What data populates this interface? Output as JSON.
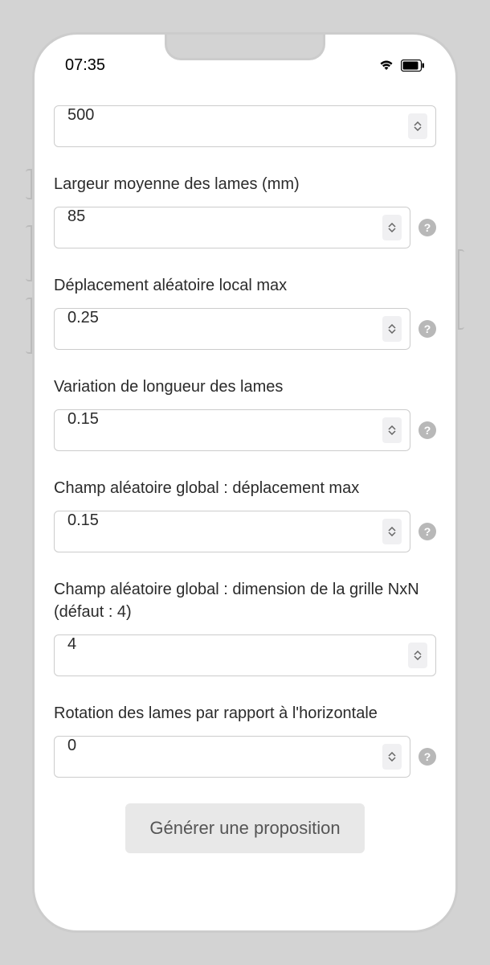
{
  "statusBar": {
    "time": "07:35"
  },
  "form": {
    "fields": [
      {
        "label": "",
        "value": "500",
        "help": false
      },
      {
        "label": "Largeur moyenne des lames (mm)",
        "value": "85",
        "help": true
      },
      {
        "label": "Déplacement aléatoire local max",
        "value": "0.25",
        "help": true
      },
      {
        "label": "Variation de longueur des lames",
        "value": "0.15",
        "help": true
      },
      {
        "label": "Champ aléatoire global : déplacement max",
        "value": "0.15",
        "help": true
      },
      {
        "label": "Champ aléatoire global : dimension de la grille NxN (défaut : 4)",
        "value": "4",
        "help": false
      },
      {
        "label": "Rotation des lames par rapport à l'horizontale",
        "value": "0",
        "help": true
      }
    ],
    "button": "Générer une proposition"
  }
}
